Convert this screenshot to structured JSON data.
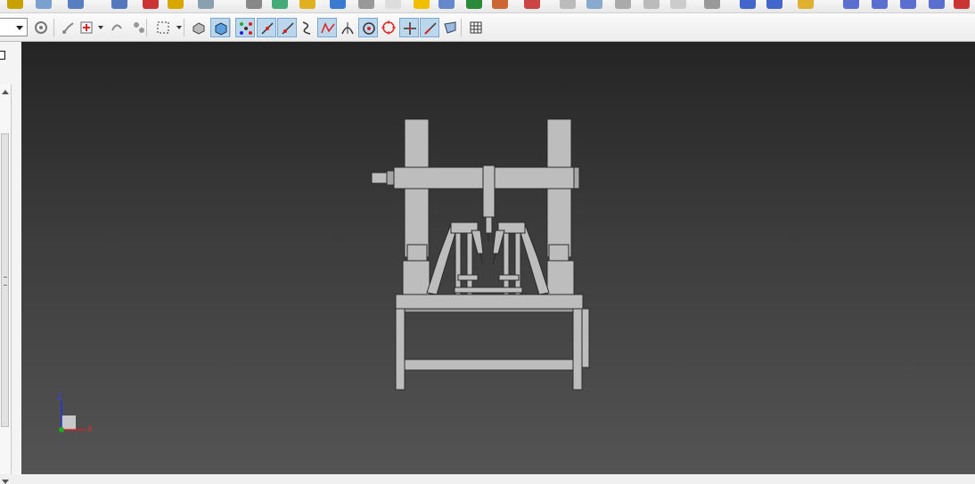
{
  "window": {
    "title": ""
  },
  "toolbar_top": {
    "icons": [
      "curve-icon",
      "surface-icon",
      "solid-icon",
      "database-icon",
      "pin-icon",
      "bucket-icon",
      "rings-icon",
      "copy-icon",
      "wing-icon",
      "cube-icon",
      "render-icon",
      "block-icon",
      "eraser-icon",
      "shaded-box-icon",
      "arch-icon",
      "image-icon",
      "gallery-icon",
      "chair-icon",
      "cloud-icon",
      "layer-icon",
      "shape-icon",
      "hidden-icon",
      "box-icon",
      "arrow-icon",
      "solid-blue-icon",
      "sheet-icon",
      "folder-icon",
      "plane-icon",
      "plane2-icon",
      "plane3-icon",
      "plane4-icon",
      "pencil-icon"
    ]
  },
  "toolbar": {
    "combo_value": "",
    "buttons": [
      {
        "name": "snap-settings-icon",
        "active": false
      },
      {
        "name": "sketch-point-icon",
        "active": false
      },
      {
        "name": "feature-point-icon",
        "active": false
      },
      {
        "name": "transform-icon",
        "active": false
      },
      {
        "name": "multi-select-icon",
        "active": false
      },
      {
        "name": "select-box-icon",
        "active": false
      },
      {
        "name": "wireframe-view-icon",
        "active": false
      },
      {
        "name": "shaded-view-icon",
        "active": true
      },
      {
        "name": "point-snap-icon",
        "active": true
      },
      {
        "name": "line-snap-icon",
        "active": true
      },
      {
        "name": "edge-snap-icon",
        "active": true
      },
      {
        "name": "curve-snap-icon",
        "active": false
      },
      {
        "name": "midpoint-snap-icon",
        "active": true
      },
      {
        "name": "tangent-snap-icon",
        "active": false
      },
      {
        "name": "center-snap-icon",
        "active": true
      },
      {
        "name": "quadrant-snap-icon",
        "active": false
      },
      {
        "name": "intersection-snap-icon",
        "active": true
      },
      {
        "name": "perpendicular-snap-icon",
        "active": true
      },
      {
        "name": "surface-snap-icon",
        "active": false
      },
      {
        "name": "grid-icon",
        "active": false
      }
    ]
  },
  "viewport": {
    "axis_labels": {
      "x": "X",
      "y": "Y",
      "z": "Z"
    },
    "model_color": "#b8b8b8",
    "axis_colors": {
      "x": "#d22222",
      "z": "#2233dd",
      "y": "#22aa22"
    }
  }
}
